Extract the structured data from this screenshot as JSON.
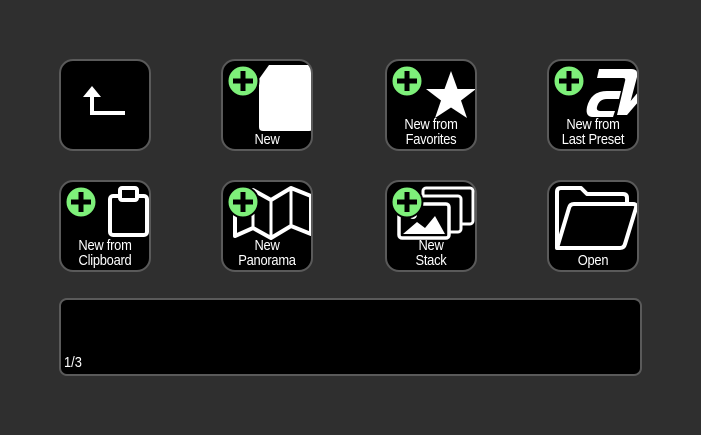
{
  "tiles": {
    "back": {
      "icon": "back-arrow-icon"
    },
    "new": {
      "line1": "New",
      "icon": "blank-page-icon"
    },
    "favorites": {
      "line1": "New from",
      "line2": "Favorites",
      "icon": "star-icon"
    },
    "last_preset": {
      "line1": "New from",
      "line2": "Last Preset",
      "icon": "preset-logo-icon"
    },
    "clipboard": {
      "line1": "New from",
      "line2": "Clipboard",
      "icon": "clipboard-icon"
    },
    "panorama": {
      "line1": "New",
      "line2": "Panorama",
      "icon": "panorama-map-icon"
    },
    "stack": {
      "line1": "New",
      "line2": "Stack",
      "icon": "image-stack-icon"
    },
    "open": {
      "line1": "Open",
      "icon": "folder-icon"
    }
  },
  "panel": {
    "page_indicator": "1/3"
  },
  "colors": {
    "background": "#2f2f2f",
    "tile": "#000000",
    "border": "#5a5a5a",
    "plus": "#7ef07a"
  }
}
